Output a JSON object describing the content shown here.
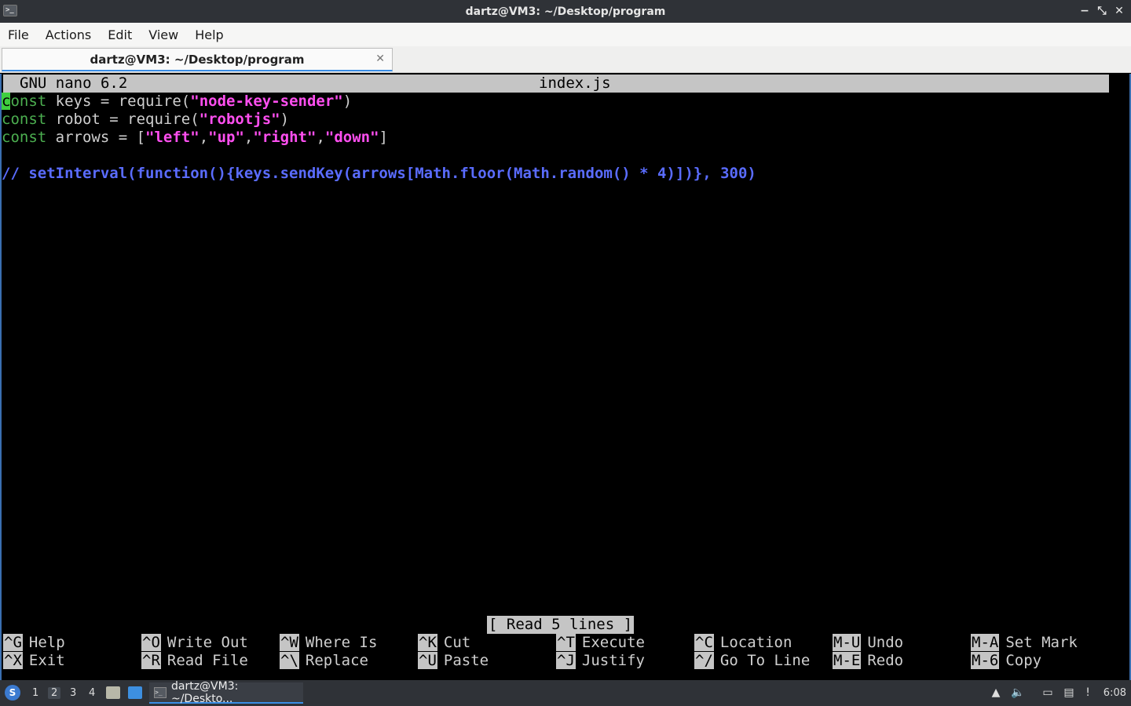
{
  "window": {
    "title": "dartz@VM3: ~/Desktop/program",
    "controls": [
      "−",
      "⤡",
      "✕"
    ]
  },
  "menu": [
    "File",
    "Actions",
    "Edit",
    "View",
    "Help"
  ],
  "tab": {
    "title": "dartz@VM3: ~/Desktop/program",
    "close": "✕"
  },
  "nano": {
    "version": "GNU nano 6.2",
    "filename": "index.js",
    "status": "[ Read 5 lines ]",
    "shortcuts": [
      {
        "key": "^G",
        "label": "Help"
      },
      {
        "key": "^O",
        "label": "Write Out"
      },
      {
        "key": "^W",
        "label": "Where Is"
      },
      {
        "key": "^K",
        "label": "Cut"
      },
      {
        "key": "^T",
        "label": "Execute"
      },
      {
        "key": "^C",
        "label": "Location"
      },
      {
        "key": "M-U",
        "label": "Undo"
      },
      {
        "key": "M-A",
        "label": "Set Mark"
      },
      {
        "key": "^X",
        "label": "Exit"
      },
      {
        "key": "^R",
        "label": "Read File"
      },
      {
        "key": "^\\",
        "label": "Replace"
      },
      {
        "key": "^U",
        "label": "Paste"
      },
      {
        "key": "^J",
        "label": "Justify"
      },
      {
        "key": "^/",
        "label": "Go To Line"
      },
      {
        "key": "M-E",
        "label": "Redo"
      },
      {
        "key": "M-6",
        "label": "Copy"
      }
    ]
  },
  "code": {
    "line1": {
      "cursor": "c",
      "kw": "onst",
      "a": " keys = require(",
      "s": "\"node-key-sender\"",
      "b": ")"
    },
    "line2": {
      "kw": "const",
      "a": " robot = require(",
      "s": "\"robotjs\"",
      "b": ")"
    },
    "line3": {
      "kw": "const",
      "a": " arrows = [",
      "s1": "\"left\"",
      "c1": ",",
      "s2": "\"up\"",
      "c2": ",",
      "s3": "\"right\"",
      "c3": ",",
      "s4": "\"down\"",
      "b": "]"
    },
    "line5": "// setInterval(function(){keys.sendKey(arrows[Math.floor(Math.random() * 4)])}, 300)"
  },
  "taskbar": {
    "workspaces": [
      "1",
      "2",
      "3",
      "4"
    ],
    "task_title": "dartz@VM3: ~/Deskto...",
    "clock": "6:08"
  }
}
